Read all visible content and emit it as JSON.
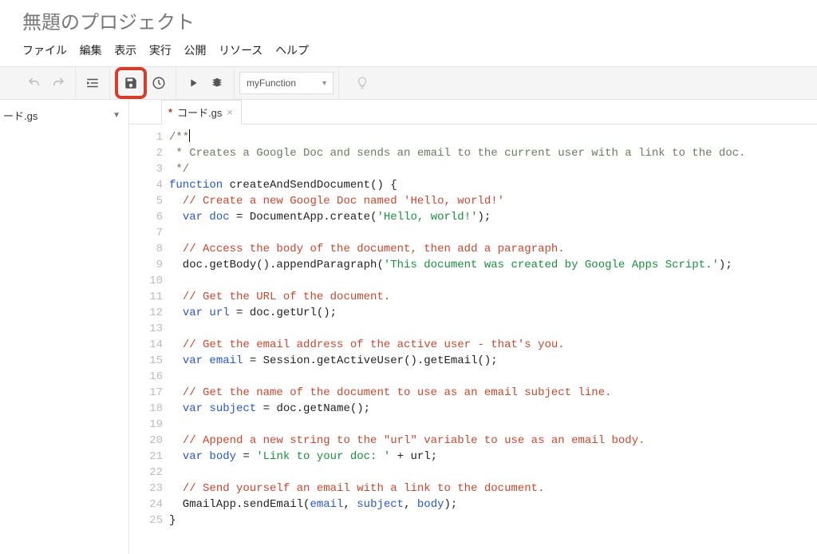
{
  "project": {
    "title": "無題のプロジェクト"
  },
  "menu": {
    "file": "ファイル",
    "edit": "編集",
    "view": "表示",
    "run": "実行",
    "publish": "公開",
    "resources": "リソース",
    "help": "ヘルプ"
  },
  "toolbar": {
    "function_selected": "myFunction"
  },
  "sidebar": {
    "items": [
      {
        "label": "ード.gs"
      }
    ]
  },
  "tabs": [
    {
      "label": "コード.gs",
      "dirty": "*"
    }
  ],
  "code": {
    "lines": [
      [
        {
          "cls": "c-doc",
          "t": "/**"
        }
      ],
      [
        {
          "cls": "c-doc",
          "t": " * Creates a Google Doc and sends an email to the current user with a link to the doc."
        }
      ],
      [
        {
          "cls": "c-doc",
          "t": " */"
        }
      ],
      [
        {
          "cls": "c-kw",
          "t": "function "
        },
        {
          "cls": "c-fn",
          "t": "createAndSendDocument"
        },
        {
          "cls": "c-op",
          "t": "() {"
        }
      ],
      [
        {
          "cls": "c-op",
          "t": "  "
        },
        {
          "cls": "c-cmt",
          "t": "// Create a new Google Doc named 'Hello, world!'"
        }
      ],
      [
        {
          "cls": "c-op",
          "t": "  "
        },
        {
          "cls": "c-kw",
          "t": "var "
        },
        {
          "cls": "c-ident",
          "t": "doc"
        },
        {
          "cls": "c-op",
          "t": " = DocumentApp.create("
        },
        {
          "cls": "c-str",
          "t": "'Hello, world!'"
        },
        {
          "cls": "c-op",
          "t": ");"
        }
      ],
      [
        {
          "cls": "c-op",
          "t": ""
        }
      ],
      [
        {
          "cls": "c-op",
          "t": "  "
        },
        {
          "cls": "c-cmt",
          "t": "// Access the body of the document, then add a paragraph."
        }
      ],
      [
        {
          "cls": "c-op",
          "t": "  doc.getBody().appendParagraph("
        },
        {
          "cls": "c-str",
          "t": "'This document was created by Google Apps Script.'"
        },
        {
          "cls": "c-op",
          "t": ");"
        }
      ],
      [
        {
          "cls": "c-op",
          "t": ""
        }
      ],
      [
        {
          "cls": "c-op",
          "t": "  "
        },
        {
          "cls": "c-cmt",
          "t": "// Get the URL of the document."
        }
      ],
      [
        {
          "cls": "c-op",
          "t": "  "
        },
        {
          "cls": "c-kw",
          "t": "var "
        },
        {
          "cls": "c-ident",
          "t": "url"
        },
        {
          "cls": "c-op",
          "t": " = doc.getUrl();"
        }
      ],
      [
        {
          "cls": "c-op",
          "t": ""
        }
      ],
      [
        {
          "cls": "c-op",
          "t": "  "
        },
        {
          "cls": "c-cmt",
          "t": "// Get the email address of the active user - that's you."
        }
      ],
      [
        {
          "cls": "c-op",
          "t": "  "
        },
        {
          "cls": "c-kw",
          "t": "var "
        },
        {
          "cls": "c-ident",
          "t": "email"
        },
        {
          "cls": "c-op",
          "t": " = Session.getActiveUser().getEmail();"
        }
      ],
      [
        {
          "cls": "c-op",
          "t": ""
        }
      ],
      [
        {
          "cls": "c-op",
          "t": "  "
        },
        {
          "cls": "c-cmt",
          "t": "// Get the name of the document to use as an email subject line."
        }
      ],
      [
        {
          "cls": "c-op",
          "t": "  "
        },
        {
          "cls": "c-kw",
          "t": "var "
        },
        {
          "cls": "c-ident",
          "t": "subject"
        },
        {
          "cls": "c-op",
          "t": " = doc.getName();"
        }
      ],
      [
        {
          "cls": "c-op",
          "t": ""
        }
      ],
      [
        {
          "cls": "c-op",
          "t": "  "
        },
        {
          "cls": "c-cmt",
          "t": "// Append a new string to the \"url\" variable to use as an email body."
        }
      ],
      [
        {
          "cls": "c-op",
          "t": "  "
        },
        {
          "cls": "c-kw",
          "t": "var "
        },
        {
          "cls": "c-ident",
          "t": "body"
        },
        {
          "cls": "c-op",
          "t": " = "
        },
        {
          "cls": "c-str",
          "t": "'Link to your doc: '"
        },
        {
          "cls": "c-op",
          "t": " + url;"
        }
      ],
      [
        {
          "cls": "c-op",
          "t": ""
        }
      ],
      [
        {
          "cls": "c-op",
          "t": "  "
        },
        {
          "cls": "c-cmt",
          "t": "// Send yourself an email with a link to the document."
        }
      ],
      [
        {
          "cls": "c-op",
          "t": "  GmailApp.sendEmail("
        },
        {
          "cls": "c-ident",
          "t": "email"
        },
        {
          "cls": "c-op",
          "t": ", "
        },
        {
          "cls": "c-ident",
          "t": "subject"
        },
        {
          "cls": "c-op",
          "t": ", "
        },
        {
          "cls": "c-ident",
          "t": "body"
        },
        {
          "cls": "c-op",
          "t": ");"
        }
      ],
      [
        {
          "cls": "c-op",
          "t": "}"
        }
      ]
    ]
  }
}
